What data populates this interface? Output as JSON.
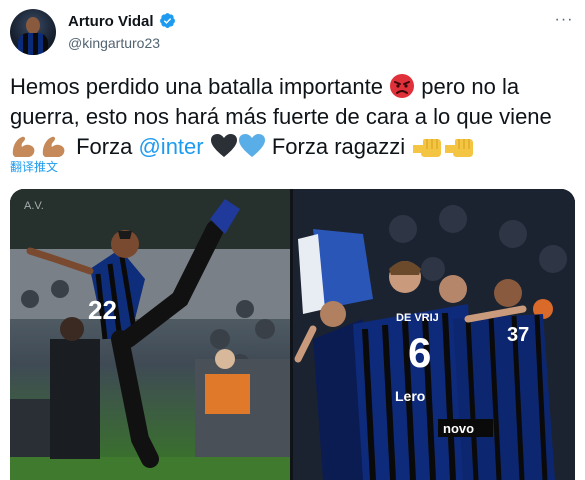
{
  "author": {
    "display_name": "Arturo Vidal",
    "handle": "@kingarturo23",
    "verified_icon": "verified-badge-icon",
    "avatar_icon": "avatar"
  },
  "menu": {
    "more_label": "···"
  },
  "tweet": {
    "line1_a": "Hemos perdido una batalla importante ",
    "line1_b": " pero no la",
    "line2": "guerra, esto nos hará más fuerte de cara a lo que viene",
    "line3_a": " Forza ",
    "mention": "@inter",
    "line3_b": " Forza ragazzi ",
    "emojis": [
      "angry-face-icon",
      "flexed-biceps-icon",
      "black-heart-icon",
      "blue-heart-icon",
      "fist-icon"
    ]
  },
  "translate_label": "翻译推文",
  "media": {
    "left": {
      "number": "22",
      "watermark": "A.V."
    },
    "right": {
      "name": "DE VRIJ",
      "number": "6",
      "number2": "37",
      "sponsor": "novo",
      "shirt_text": "Lero"
    }
  },
  "colors": {
    "text": "#0f1419",
    "secondary": "#536471",
    "accent": "#1d9bf0",
    "inter_blue": "#0a2a7a"
  }
}
